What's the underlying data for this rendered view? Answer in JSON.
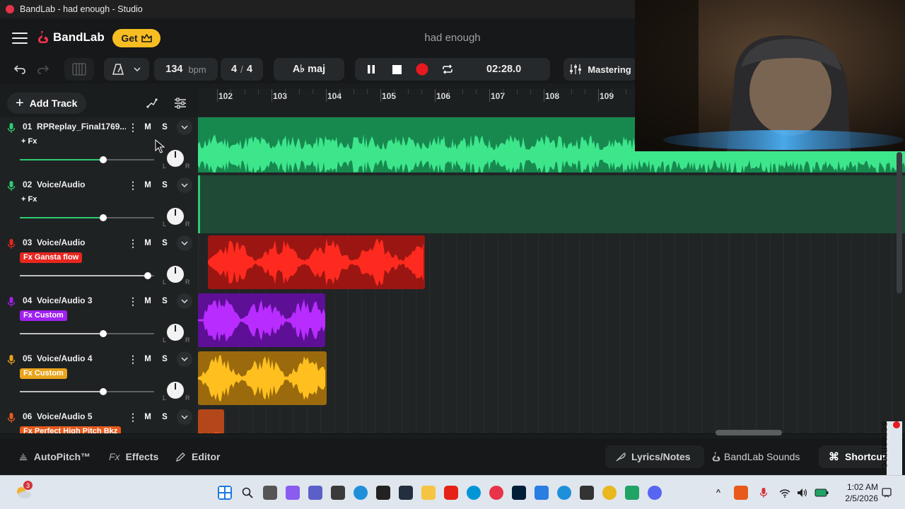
{
  "window": {
    "title": "BandLab - had enough - Studio"
  },
  "header": {
    "logo": "BandLab",
    "get_label": "Get",
    "project_title": "had enough"
  },
  "toolbar": {
    "bpm_value": "134",
    "bpm_label": "bpm",
    "time_sig_num": "4",
    "time_sig_sep": "/",
    "time_sig_den": "4",
    "key": "A♭ maj",
    "time": "02:28.0",
    "mastering": "Mastering"
  },
  "tracks_header": {
    "add_track": "Add Track"
  },
  "ruler": {
    "bars": [
      "102",
      "103",
      "104",
      "105",
      "106",
      "107",
      "108",
      "109"
    ]
  },
  "tracks": [
    {
      "num": "01",
      "name": "RPReplay_Final1769...",
      "fx": "+ Fx",
      "fx_style": "plain",
      "color": "#33d17a",
      "mic_color": "#2ecc71",
      "volume": 0.62,
      "mute": "M",
      "solo": "S",
      "pan_l": "L",
      "pan_r": "R"
    },
    {
      "num": "02",
      "name": "Voice/Audio",
      "fx": "+ Fx",
      "fx_style": "plain",
      "color": "#2aa363",
      "mic_color": "#2ecc71",
      "volume": 0.62,
      "mute": "M",
      "solo": "S",
      "pan_l": "L",
      "pan_r": "R"
    },
    {
      "num": "03",
      "name": "Voice/Audio",
      "fx": "Fx Gansta flow",
      "fx_style": "tag",
      "color": "#e8261f",
      "mic_color": "#e8261f",
      "volume": 0.95,
      "mute": "M",
      "solo": "S",
      "pan_l": "L",
      "pan_r": "R"
    },
    {
      "num": "04",
      "name": "Voice/Audio 3",
      "fx": "Fx Custom",
      "fx_style": "tag",
      "color": "#a020f0",
      "mic_color": "#a020f0",
      "volume": 0.62,
      "mute": "M",
      "solo": "S",
      "pan_l": "L",
      "pan_r": "R"
    },
    {
      "num": "05",
      "name": "Voice/Audio 4",
      "fx": "Fx Custom",
      "fx_style": "tag",
      "color": "#e8a41c",
      "mic_color": "#e8a41c",
      "volume": 0.62,
      "mute": "M",
      "solo": "S",
      "pan_l": "L",
      "pan_r": "R"
    },
    {
      "num": "06",
      "name": "Voice/Audio 5",
      "fx": "Fx Perfect High Pitch Bkz",
      "fx_style": "tag",
      "color": "#e85a1c",
      "mic_color": "#e85a1c",
      "volume": 0.62,
      "mute": "M",
      "solo": "S",
      "pan_l": "L",
      "pan_r": "R"
    }
  ],
  "bottom": {
    "autopitch": "AutoPitch™",
    "effects_prefix": "Fx",
    "effects": "Effects",
    "editor": "Editor",
    "lyrics": "Lyrics/Notes",
    "sounds": "BandLab Sounds",
    "shortcuts": "Shortcuts"
  },
  "overlay": {
    "screenrec": "screenrec"
  },
  "taskbar": {
    "time": "1:02 AM",
    "date": "2/5/2026",
    "badge": "3"
  }
}
